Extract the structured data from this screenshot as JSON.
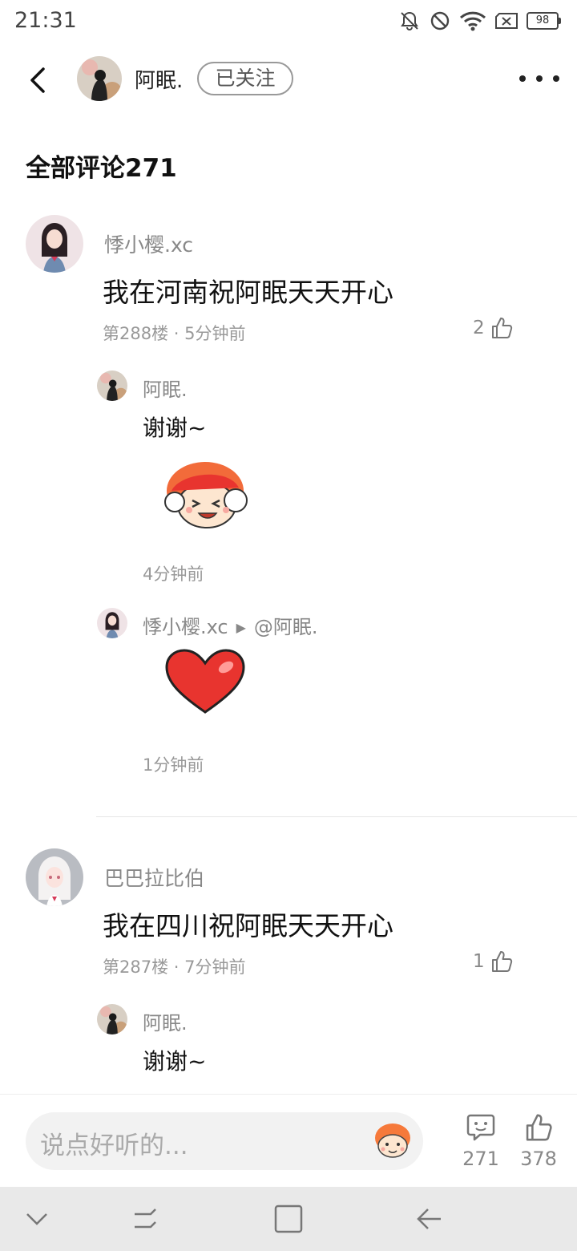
{
  "status_bar": {
    "time": "21:31",
    "battery": "98"
  },
  "header": {
    "username": "阿眠.",
    "follow_label": "已关注"
  },
  "comments_title": "全部评论271",
  "comments": [
    {
      "user": "悸小樱.xc",
      "text": "我在河南祝阿眠天天开心",
      "meta": "第288楼 · 5分钟前",
      "likes": "2",
      "replies": [
        {
          "user": "阿眠.",
          "text": "谢谢~",
          "sticker": "laughing-mascot",
          "time": "4分钟前"
        },
        {
          "user": "悸小樱.xc",
          "reply_to": "@阿眠.",
          "sticker": "red-heart",
          "time": "1分钟前"
        }
      ]
    },
    {
      "user": "巴巴拉比伯",
      "text": "我在四川祝阿眠天天开心",
      "meta": "第287楼 · 7分钟前",
      "likes": "1",
      "replies": [
        {
          "user": "阿眠.",
          "text": "谢谢~"
        }
      ]
    }
  ],
  "input_bar": {
    "placeholder": "说点好听的...",
    "comment_count": "271",
    "like_count": "378"
  },
  "icons": {
    "back": "chevron-left-icon",
    "more": "more-dots-icon",
    "like": "thumbs-up-icon",
    "comment": "comment-bubble-icon",
    "emoji": "mascot-emoji-icon"
  },
  "colors": {
    "accent_red": "#e8342f",
    "mascot_orange": "#f6793a",
    "text_gray": "#888888"
  }
}
